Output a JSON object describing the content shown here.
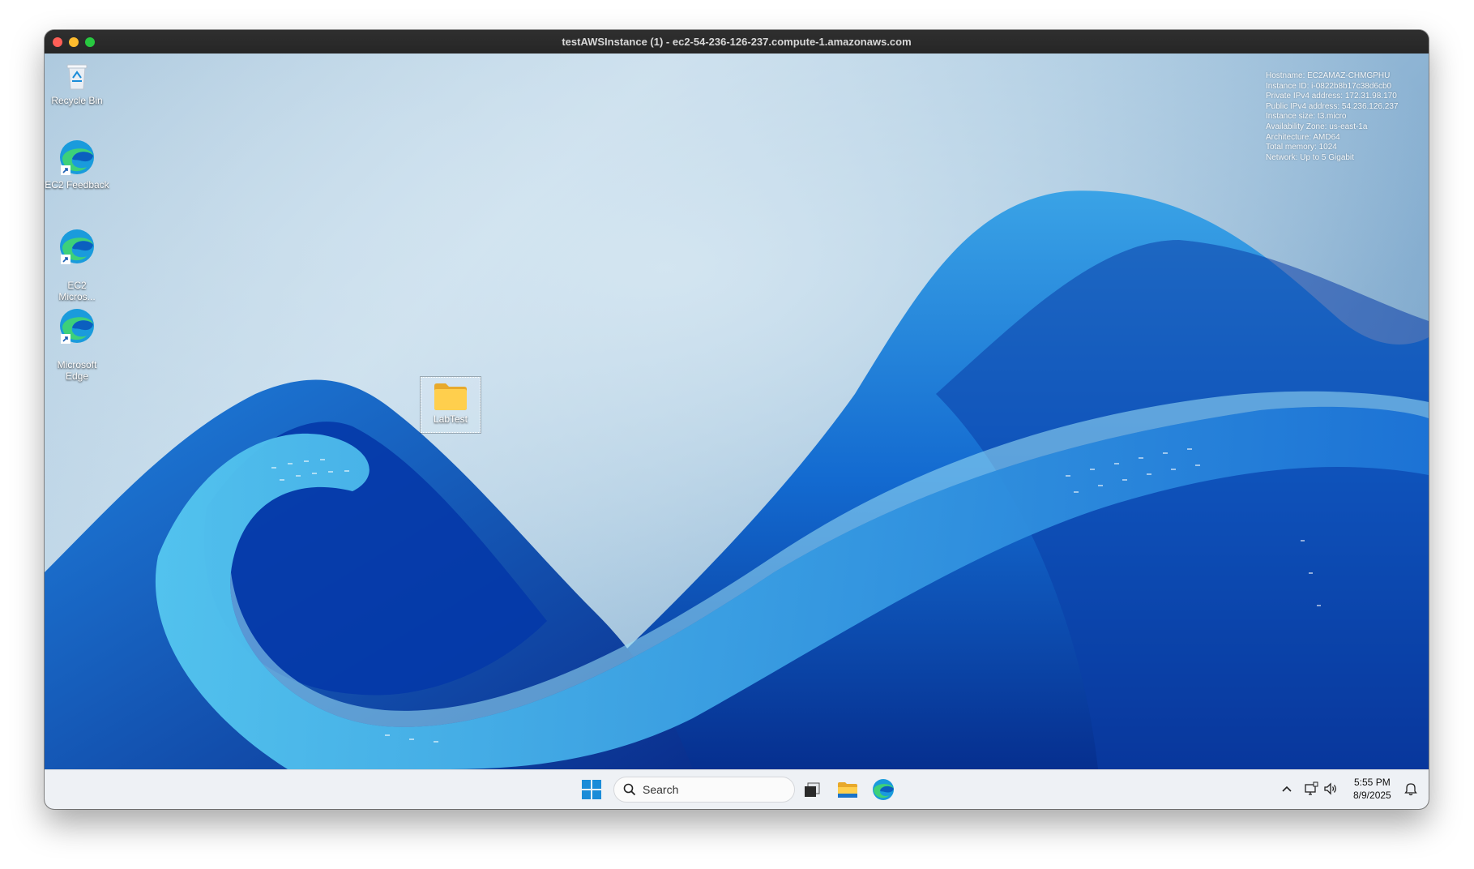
{
  "window": {
    "title": "testAWSInstance (1) - ec2-54-236-126-237.compute-1.amazonaws.com"
  },
  "desktop": {
    "icons": [
      {
        "label": "Recycle Bin",
        "icon": "recycle-bin-icon"
      },
      {
        "label": "EC2 Feedback",
        "icon": "edge-icon"
      },
      {
        "label": "EC2\nMicros...",
        "icon": "edge-icon"
      },
      {
        "label": "Microsoft\nEdge",
        "icon": "edge-icon"
      }
    ],
    "folder": {
      "label": "LabTest",
      "icon": "folder-icon"
    }
  },
  "instance_info": {
    "lines": [
      "Hostname: EC2AMAZ-CHMGPHU",
      "Instance ID: i-0822b8b17c38d6cb0",
      "Private IPv4 address: 172.31.98.170",
      "Public IPv4 address: 54.236.126.237",
      "Instance size: t3.micro",
      "Availability Zone: us-east-1a",
      "Architecture: AMD64",
      "Total memory: 1024",
      "Network: Up to 5 Gigabit"
    ]
  },
  "taskbar": {
    "search_placeholder": "Search",
    "pinned": [
      "task-view-icon",
      "file-explorer-icon",
      "edge-icon"
    ],
    "tray": [
      "chevron-up-icon",
      "network-icon",
      "volume-icon",
      "notification-icon"
    ],
    "time": "5:55 PM",
    "date": "8/9/2025"
  },
  "colors": {
    "accent": "#1a8cd8",
    "titlebar": "#2b2b2b",
    "taskbar": "#eef1f5"
  }
}
